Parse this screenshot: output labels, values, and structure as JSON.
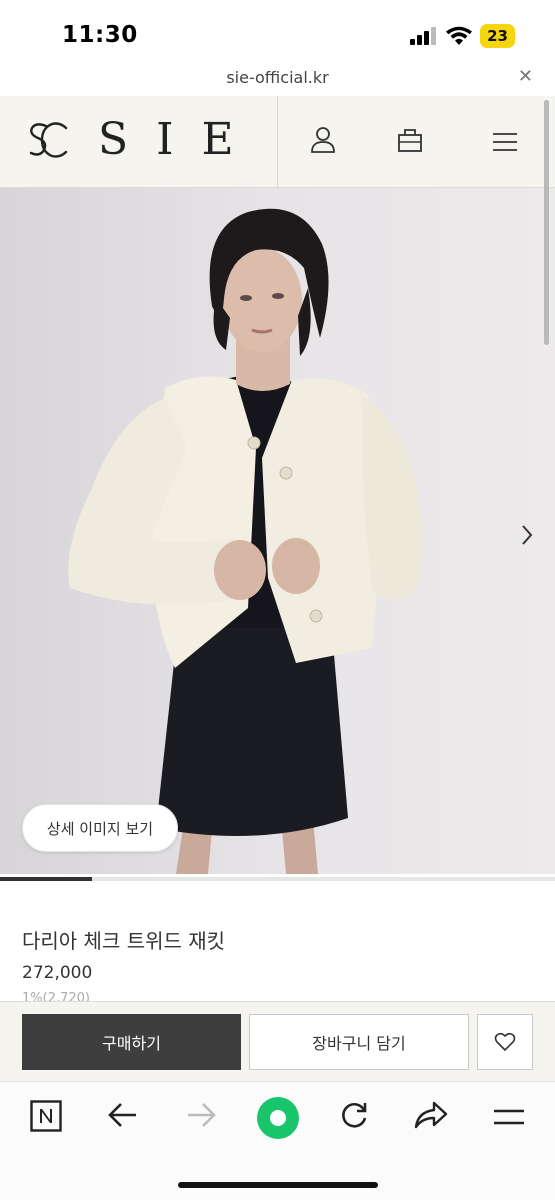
{
  "status_bar": {
    "time": "11:30",
    "battery": "23",
    "icons": [
      "signal-icon",
      "wifi-icon",
      "battery-icon"
    ]
  },
  "url_bar": {
    "url": "sie-official.kr",
    "close_icon": "close-icon"
  },
  "header": {
    "logo_text": "SIE",
    "logo_icon": "sie-logo-mark",
    "icons": [
      "user-icon",
      "bag-icon",
      "menu-icon"
    ]
  },
  "product": {
    "image_icon": "product-photo",
    "detail_button_label": "상세 이미지 보기",
    "next_icon": "chevron-right-icon",
    "gallery_progress": 0.165,
    "name": "다리아 체크 트위드 재킷",
    "price": "272,000",
    "points": "1%(2,720)"
  },
  "actions": {
    "buy_label": "구매하기",
    "cart_label": "장바구니 담기",
    "wishlist_icon": "heart-icon"
  },
  "browser_toolbar": {
    "icons": [
      "naver-icon",
      "back-icon",
      "forward-icon",
      "home-icon",
      "refresh-icon",
      "share-icon",
      "menu-icon"
    ]
  },
  "colors": {
    "accent_green": "#19c56a",
    "header_bg": "#f5f4ef",
    "buy_button_bg": "#3e3e3e"
  }
}
